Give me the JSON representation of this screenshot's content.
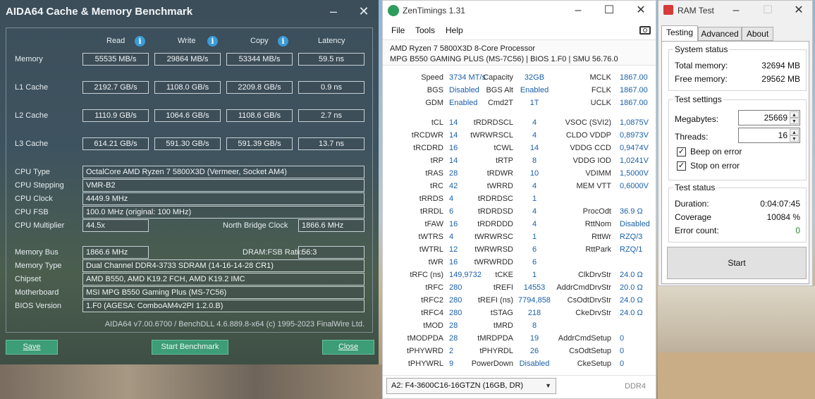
{
  "aida": {
    "title": "AIDA64 Cache & Memory Benchmark",
    "headers": {
      "read": "Read",
      "write": "Write",
      "copy": "Copy",
      "latency": "Latency"
    },
    "bench_rows": [
      {
        "label": "Memory",
        "read": "55535 MB/s",
        "write": "29864 MB/s",
        "copy": "53344 MB/s",
        "latency": "59.5 ns"
      },
      {
        "label": "L1 Cache",
        "read": "2192.7 GB/s",
        "write": "1108.0 GB/s",
        "copy": "2209.8 GB/s",
        "latency": "0.9 ns"
      },
      {
        "label": "L2 Cache",
        "read": "1110.9 GB/s",
        "write": "1064.6 GB/s",
        "copy": "1108.6 GB/s",
        "latency": "2.7 ns"
      },
      {
        "label": "L3 Cache",
        "read": "614.21 GB/s",
        "write": "591.30 GB/s",
        "copy": "591.39 GB/s",
        "latency": "13.7 ns"
      }
    ],
    "cpu_type_label": "CPU Type",
    "cpu_type": "OctalCore AMD Ryzen 7 5800X3D  (Vermeer, Socket AM4)",
    "cpu_stepping_label": "CPU Stepping",
    "cpu_stepping": "VMR-B2",
    "cpu_clock_label": "CPU Clock",
    "cpu_clock": "4449.9 MHz",
    "cpu_fsb_label": "CPU FSB",
    "cpu_fsb": "100.0 MHz  (original: 100 MHz)",
    "cpu_multiplier_label": "CPU Multiplier",
    "cpu_multiplier": "44.5x",
    "nb_clock_label": "North Bridge Clock",
    "nb_clock": "1866.6 MHz",
    "memory_bus_label": "Memory Bus",
    "memory_bus": "1866.6 MHz",
    "dram_fsb_label": "DRAM:FSB Ratio",
    "dram_fsb": "56:3",
    "memory_type_label": "Memory Type",
    "memory_type": "Dual Channel DDR4-3733 SDRAM  (14-16-14-28 CR1)",
    "chipset_label": "Chipset",
    "chipset": "AMD B550, AMD K19.2 FCH, AMD K19.2 IMC",
    "motherboard_label": "Motherboard",
    "motherboard": "MSI MPG B550 Gaming Plus (MS-7C56)",
    "bios_label": "BIOS Version",
    "bios": "1.F0  (AGESA: ComboAM4v2PI 1.2.0.B)",
    "footer": "AIDA64 v7.00.6700 / BenchDLL 4.6.889.8-x64  (c) 1995-2023 FinalWire Ltd.",
    "buttons": {
      "save": "Save",
      "start": "Start Benchmark",
      "close": "Close"
    }
  },
  "zen": {
    "title": "ZenTimings 1.31",
    "menu": [
      "File",
      "Tools",
      "Help"
    ],
    "cpu": "AMD Ryzen 7 5800X3D 8-Core Processor",
    "board": "MPG B550 GAMING PLUS (MS-7C56) | BIOS 1.F0 | SMU 56.76.0",
    "col1": [
      [
        "Speed",
        "3734 MT/s"
      ],
      [
        "BGS",
        "Disabled"
      ],
      [
        "GDM",
        "Enabled"
      ],
      [
        "tCL",
        "14"
      ],
      [
        "tRCDWR",
        "14"
      ],
      [
        "tRCDRD",
        "16"
      ],
      [
        "tRP",
        "14"
      ],
      [
        "tRAS",
        "28"
      ],
      [
        "tRC",
        "42"
      ],
      [
        "tRRDS",
        "4"
      ],
      [
        "tRRDL",
        "6"
      ],
      [
        "tFAW",
        "16"
      ],
      [
        "tWTRS",
        "4"
      ],
      [
        "tWTRL",
        "12"
      ],
      [
        "tWR",
        "16"
      ],
      [
        "tRFC (ns)",
        "149,9732"
      ],
      [
        "tRFC",
        "280"
      ],
      [
        "tRFC2",
        "280"
      ],
      [
        "tRFC4",
        "280"
      ],
      [
        "tMOD",
        "28"
      ],
      [
        "tMODPDA",
        "28"
      ],
      [
        "tPHYWRD",
        "2"
      ],
      [
        "tPHYWRL",
        "9"
      ]
    ],
    "col2": [
      [
        "Capacity",
        "32GB"
      ],
      [
        "BGS Alt",
        "Enabled"
      ],
      [
        "Cmd2T",
        "1T"
      ],
      [
        "tRDRDSCL",
        "4"
      ],
      [
        "tWRWRSCL",
        "4"
      ],
      [
        "tCWL",
        "14"
      ],
      [
        "tRTP",
        "8"
      ],
      [
        "tRDWR",
        "10"
      ],
      [
        "tWRRD",
        "4"
      ],
      [
        "tRDRDSC",
        "1"
      ],
      [
        "tRDRDSD",
        "4"
      ],
      [
        "tRDRDDD",
        "4"
      ],
      [
        "tWRWRSC",
        "1"
      ],
      [
        "tWRWRSD",
        "6"
      ],
      [
        "tWRWRDD",
        "6"
      ],
      [
        "tCKE",
        "1"
      ],
      [
        "tREFI",
        "14553"
      ],
      [
        "tREFI (ns)",
        "7794,858"
      ],
      [
        "tSTAG",
        "218"
      ],
      [
        "tMRD",
        "8"
      ],
      [
        "tMRDPDA",
        "19"
      ],
      [
        "tPHYRDL",
        "26"
      ],
      [
        "PowerDown",
        "Disabled"
      ]
    ],
    "col3": [
      [
        "MCLK",
        "1867.00"
      ],
      [
        "FCLK",
        "1867.00"
      ],
      [
        "UCLK",
        "1867.00"
      ],
      [
        "VSOC (SVI2)",
        "1,0875V"
      ],
      [
        "CLDO VDDP",
        "0,8973V"
      ],
      [
        "VDDG CCD",
        "0,9474V"
      ],
      [
        "VDDG IOD",
        "1,0241V"
      ],
      [
        "VDIMM",
        "1,5000V"
      ],
      [
        "MEM VTT",
        "0,6000V"
      ],
      [
        "",
        ""
      ],
      [
        "ProcOdt",
        "36.9 Ω"
      ],
      [
        "RttNom",
        "Disabled"
      ],
      [
        "RttWr",
        "RZQ/3"
      ],
      [
        "RttPark",
        "RZQ/1"
      ],
      [
        "",
        ""
      ],
      [
        "ClkDrvStr",
        "24.0 Ω"
      ],
      [
        "AddrCmdDrvStr",
        "20.0 Ω"
      ],
      [
        "CsOdtDrvStr",
        "24.0 Ω"
      ],
      [
        "CkeDrvStr",
        "24.0 Ω"
      ],
      [
        "",
        ""
      ],
      [
        "AddrCmdSetup",
        "0"
      ],
      [
        "CsOdtSetup",
        "0"
      ],
      [
        "CkeSetup",
        "0"
      ]
    ],
    "module": "A2: F4-3600C16-16GTZN (16GB, DR)",
    "ddr": "DDR4"
  },
  "ram": {
    "title": "RAM Test",
    "tabs": [
      "Testing",
      "Advanced",
      "About"
    ],
    "system_status": "System status",
    "total_memory_label": "Total memory:",
    "total_memory": "32694 MB",
    "free_memory_label": "Free memory:",
    "free_memory": "29562 MB",
    "test_settings": "Test settings",
    "megabytes_label": "Megabytes:",
    "megabytes": "25669",
    "threads_label": "Threads:",
    "threads": "16",
    "beep_label": "Beep on error",
    "stop_label": "Stop on error",
    "test_status": "Test status",
    "duration_label": "Duration:",
    "duration": "0:04:07:45",
    "coverage_label": "Coverage",
    "coverage": "10084 %",
    "errors_label": "Error count:",
    "errors": "0",
    "start": "Start",
    "colors": {
      "ok": "#2b8a2b"
    }
  }
}
